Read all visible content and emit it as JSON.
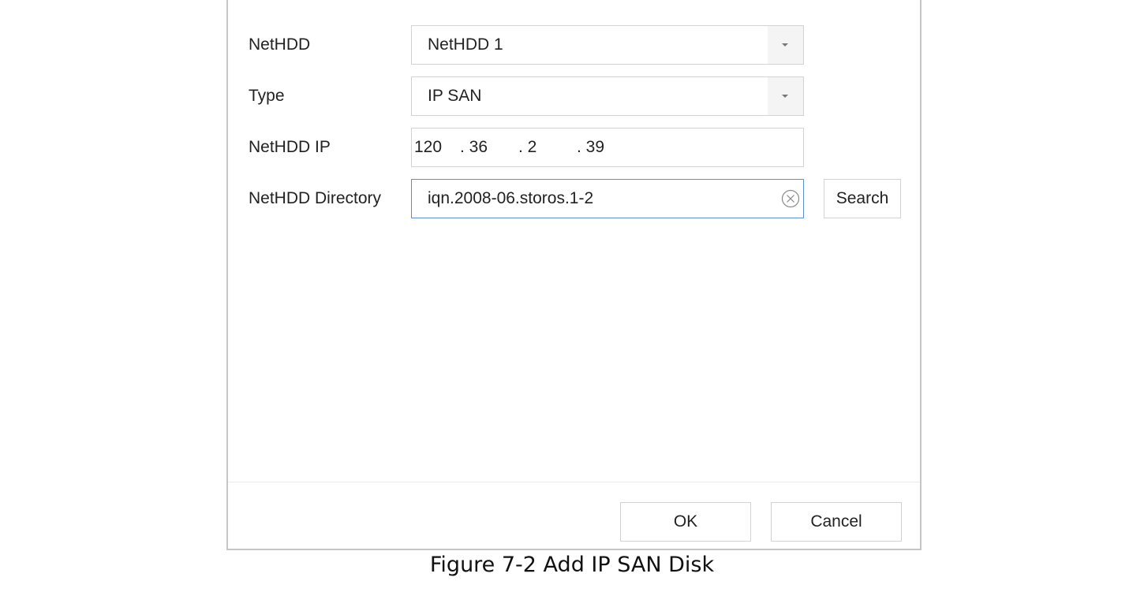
{
  "form": {
    "nethdd": {
      "label": "NetHDD",
      "value": "NetHDD 1"
    },
    "type": {
      "label": "Type",
      "value": "IP SAN"
    },
    "ip": {
      "label": "NetHDD IP",
      "octets": [
        "120",
        ". 36",
        ". 2",
        ". 39"
      ]
    },
    "directory": {
      "label": "NetHDD Directory",
      "value": "iqn.2008-06.storos.1-2",
      "search_label": "Search"
    }
  },
  "footer": {
    "ok_label": "OK",
    "cancel_label": "Cancel"
  },
  "caption": "Figure 7-2 Add IP SAN Disk",
  "icons": {
    "dropdown": "caret-down-icon",
    "clear": "clear-circle-x-icon"
  },
  "colors": {
    "border": "#d3d3d3",
    "focus_border": "#5b8fd8",
    "dialog_border": "#c6c6c6",
    "dropdown_bg": "#f4f4f4"
  }
}
